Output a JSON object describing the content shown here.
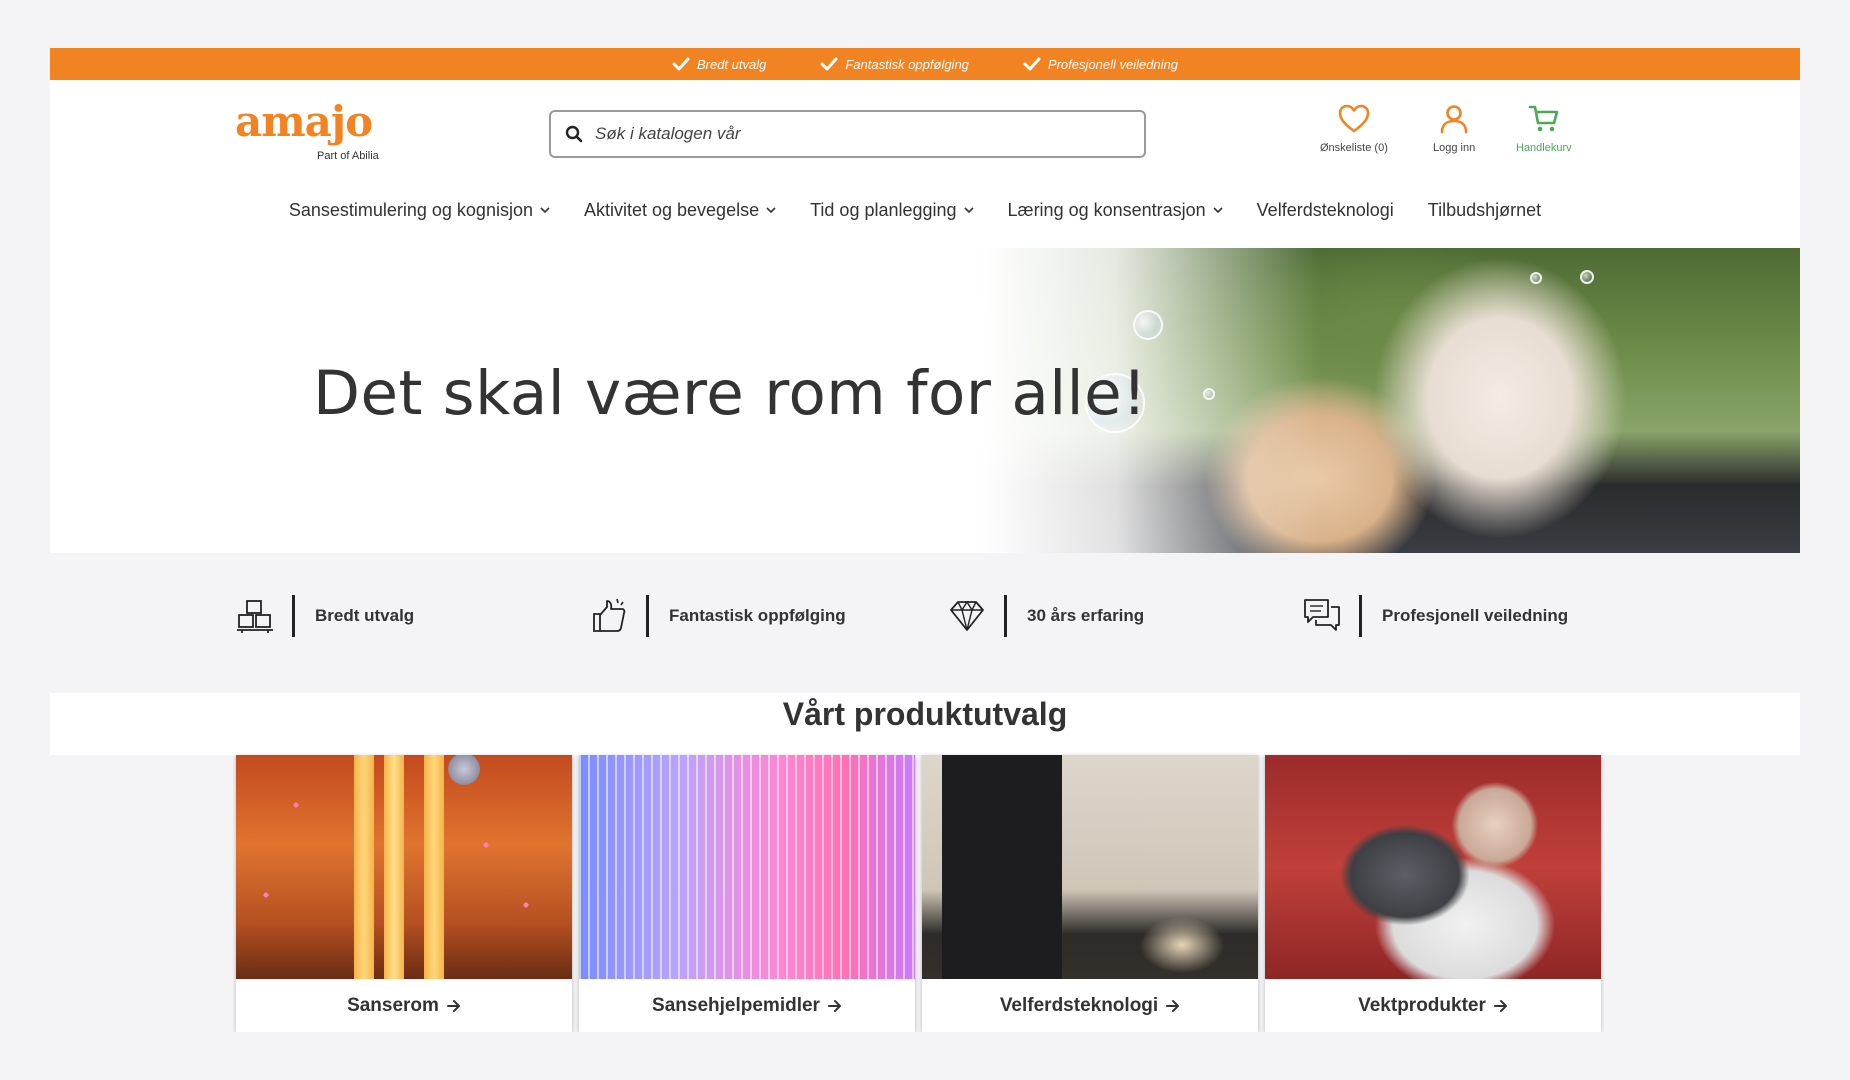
{
  "promo": {
    "items": [
      "Bredt utvalg",
      "Fantastisk oppfølging",
      "Profesjonell veiledning"
    ]
  },
  "header": {
    "logo": "amajo",
    "logo_sub": "Part of Abilia",
    "search_placeholder": "Søk i katalogen vår",
    "wishlist_label": "Ønskeliste (0)",
    "login_label": "Logg inn",
    "cart_label": "Handlekurv"
  },
  "nav": {
    "items": [
      {
        "label": "Sansestimulering og kognisjon",
        "dropdown": true
      },
      {
        "label": "Aktivitet og bevegelse",
        "dropdown": true
      },
      {
        "label": "Tid og planlegging",
        "dropdown": true
      },
      {
        "label": "Læring og konsentrasjon",
        "dropdown": true
      },
      {
        "label": "Velferdsteknologi",
        "dropdown": false
      },
      {
        "label": "Tilbudshjørnet",
        "dropdown": false
      }
    ]
  },
  "hero": {
    "title": "Det skal være rom for alle!"
  },
  "features": {
    "items": [
      {
        "label": "Bredt utvalg",
        "icon": "boxes-icon"
      },
      {
        "label": "Fantastisk oppfølging",
        "icon": "thumbs-up-icon"
      },
      {
        "label": "30 års erfaring",
        "icon": "diamond-icon"
      },
      {
        "label": "Profesjonell veiledning",
        "icon": "chat-bubbles-icon"
      }
    ]
  },
  "products": {
    "title": "Vårt produktutvalg",
    "items": [
      {
        "label": "Sanserom"
      },
      {
        "label": "Sansehjelpemidler"
      },
      {
        "label": "Velferdsteknologi"
      },
      {
        "label": "Vektprodukter"
      }
    ]
  },
  "colors": {
    "accent": "#f28322",
    "cart_green": "#4caa55",
    "text": "#333333",
    "background": "#f4f4f6"
  }
}
